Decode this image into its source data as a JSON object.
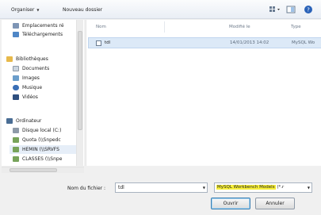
{
  "toolbar": {
    "organize_label": "Organiser",
    "new_folder_label": "Nouveau dossier"
  },
  "nav": {
    "items": [
      {
        "label": "Emplacements ré",
        "icon": "recent-places-icon",
        "color": "#7e95b5"
      },
      {
        "label": "Téléchargements",
        "icon": "downloads-icon",
        "color": "#4f86c6"
      },
      {
        "label": "Bibliothèques",
        "icon": "libraries-icon",
        "color": "#e7b94b"
      },
      {
        "label": "Documents",
        "icon": "documents-icon",
        "color": "#cbd5df"
      },
      {
        "label": "Images",
        "icon": "images-icon",
        "color": "#6b9ecb"
      },
      {
        "label": "Musique",
        "icon": "music-icon",
        "color": "#3a6fb6"
      },
      {
        "label": "Vidéos",
        "icon": "videos-icon",
        "color": "#2f4f7f"
      },
      {
        "label": "Ordinateur",
        "icon": "computer-icon",
        "color": "#4a6d94"
      },
      {
        "label": "Disque local (C:)",
        "icon": "drive-icon",
        "color": "#8e9aa8"
      },
      {
        "label": "Quota (\\\\Snpedc",
        "icon": "network-drive-icon",
        "color": "#77a35a"
      },
      {
        "label": "HEMIN (\\\\SRVFS",
        "icon": "network-drive-icon",
        "color": "#77a35a"
      },
      {
        "label": "CLASSES (\\\\Snpe",
        "icon": "network-drive-icon",
        "color": "#77a35a"
      }
    ]
  },
  "files": {
    "columns": [
      "Nom",
      "Modifié le",
      "Type"
    ],
    "rows": [
      {
        "name": "tdl",
        "modified": "14/01/2013 14:02",
        "type": "MySQL Wo"
      }
    ]
  },
  "bottom": {
    "filename_label": "Nom du fichier :",
    "filename_value": "tdl",
    "filetype_value": "MySQL Workbench Models",
    "filetype_suffix": "(*.r",
    "open_label": "Ouvrir",
    "cancel_label": "Annuler"
  },
  "colors": {
    "highlight": "#f7ef3a",
    "selection": "#dce9f7"
  }
}
